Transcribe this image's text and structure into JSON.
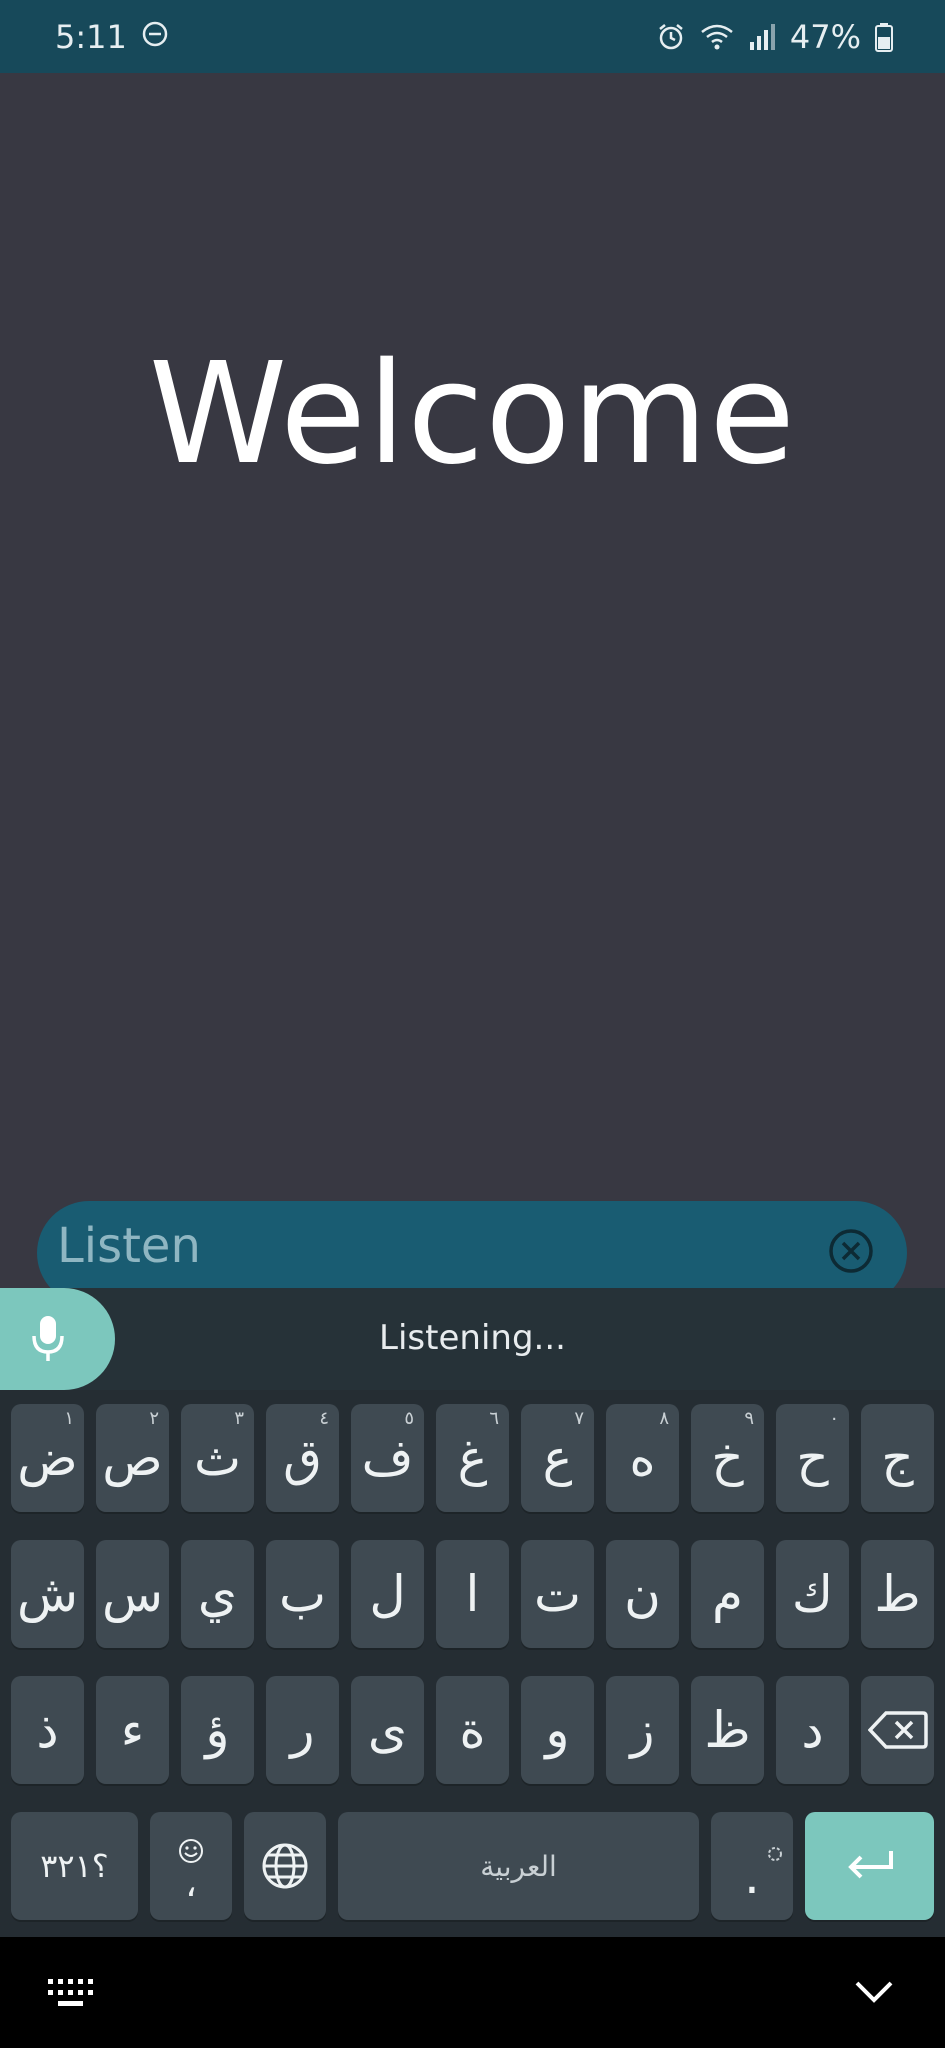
{
  "status": {
    "time": "5:11",
    "battery": "47%",
    "icons": [
      "dnd-icon",
      "alarm-icon",
      "wifi-icon",
      "signal-icon",
      "battery-icon"
    ]
  },
  "app": {
    "title": "Welcome"
  },
  "search": {
    "placeholder": "Listen",
    "value": ""
  },
  "voice": {
    "status": "Listening..."
  },
  "keyboard": {
    "row1": [
      {
        "char": "ض",
        "hint": "١"
      },
      {
        "char": "ص",
        "hint": "٢"
      },
      {
        "char": "ث",
        "hint": "٣"
      },
      {
        "char": "ق",
        "hint": "٤"
      },
      {
        "char": "ف",
        "hint": "٥"
      },
      {
        "char": "غ",
        "hint": "٦"
      },
      {
        "char": "ع",
        "hint": "٧"
      },
      {
        "char": "ه",
        "hint": "٨"
      },
      {
        "char": "خ",
        "hint": "٩"
      },
      {
        "char": "ح",
        "hint": "٠"
      },
      {
        "char": "ج",
        "hint": ""
      }
    ],
    "row2": [
      "ش",
      "س",
      "ي",
      "ب",
      "ل",
      "ا",
      "ت",
      "ن",
      "م",
      "ك",
      "ط"
    ],
    "row3": [
      "ذ",
      "ء",
      "ؤ",
      "ر",
      "ى",
      "ة",
      "و",
      "ز",
      "ظ",
      "د"
    ],
    "symbols_label": "؟٣٢١",
    "comma_label": "،",
    "space_label": "العربية",
    "period_label": ".",
    "colors": {
      "key": "#3f4a52",
      "accent": "#7cc7bd",
      "background": "#252d33"
    }
  }
}
